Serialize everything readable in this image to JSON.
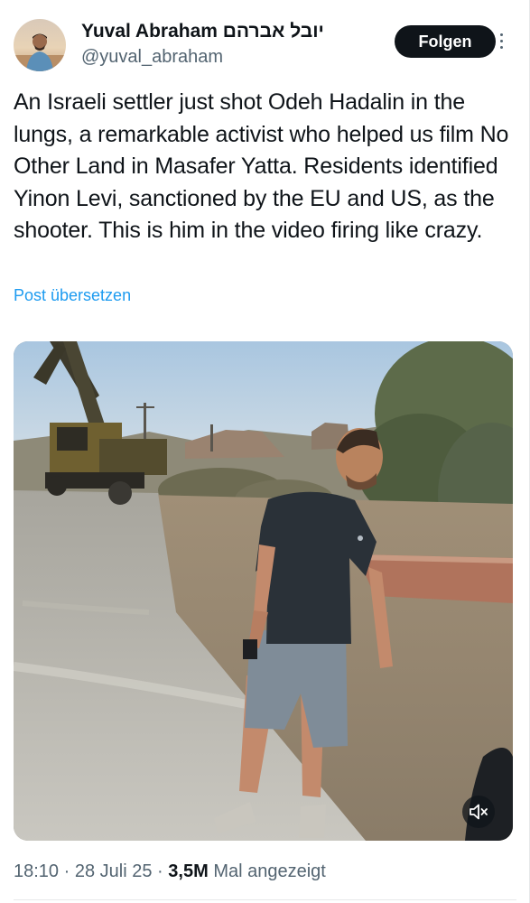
{
  "author": {
    "display_name": "Yuval Abraham יובל אברהם",
    "handle": "@yuval_abraham",
    "follow_label": "Folgen"
  },
  "tweet": {
    "text": "An Israeli settler just shot Odeh Hadalin in the lungs, a remarkable activist who helped us film No Other Land in Masafer Yatta. Residents identified Yinon Levi, sanctioned by the EU and US, as the shooter. This is him in the video firing like crazy.",
    "translate_label": "Post übersetzen"
  },
  "media": {
    "type": "video",
    "mute_icon": "speaker-muted-icon"
  },
  "meta": {
    "time": "18:10",
    "separator": "·",
    "date": "28 Juli 25",
    "views_count": "3,5M",
    "views_label": "Mal angezeigt"
  },
  "colors": {
    "text_primary": "#0f1419",
    "text_secondary": "#536471",
    "link": "#1d9bf0",
    "follow_button_bg": "#0f1419",
    "divider": "#e7e9ea"
  }
}
